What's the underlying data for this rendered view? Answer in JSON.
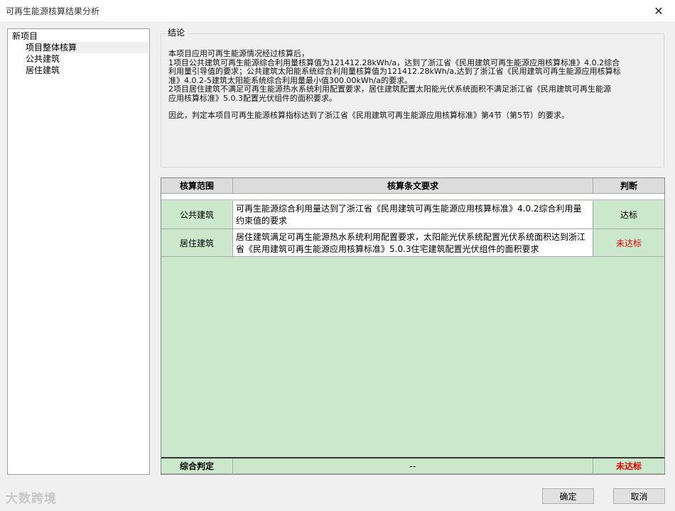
{
  "window": {
    "title": "可再生能源核算结果分析",
    "close_icon": "close-icon"
  },
  "tree": {
    "root": "新项目",
    "items": [
      "项目整体核算",
      "公共建筑",
      "居住建筑"
    ],
    "selected": "项目整体核算"
  },
  "conclusion": {
    "legend": "结论",
    "lines": [
      "本项目应用可再生能源情况经过核算后，",
      " 1项目公共建筑可再生能源综合利用量核算值为121412.28kWh/a，达到了浙江省《民用建筑可再生能源应用核算标准》4.0.2综合",
      "利用量引导值的要求；公共建筑太阳能系统综合利用量核算值为121412.28kWh/a,达到了浙江省《民用建筑可再生能源应用核算标",
      "准》4.0.2-5建筑太阳能系统综合利用量最小值300.00kWh/a的要求。",
      " 2项目居住建筑不满足可再生能源热水系统利用配置要求，居住建筑配置太阳能光伏系统面积不满足浙江省《民用建筑可再生能源",
      "应用核算标准》5.0.3配置光伏组件的面积要求。"
    ],
    "final": "因此，判定本项目可再生能源核算指标达到了浙江省《民用建筑可再生能源应用核算标准》第4节（第5节）的要求。"
  },
  "grid": {
    "headers": [
      "核算范围",
      "核算条文要求",
      "判断"
    ],
    "rows": [
      {
        "scope": "公共建筑",
        "req": "可再生能源综合利用量达到了浙江省《民用建筑可再生能源应用核算标准》4.0.2综合利用量约束值的要求",
        "result": "达标"
      },
      {
        "scope": "居住建筑",
        "req": "居住建筑满足可再生能源热水系统利用配置要求，太阳能光伏系统配置光伏系统面积达到浙江省《民用建筑可再生能源应用核算标准》5.0.3住宅建筑配置光伏组件的面积要求",
        "result": "未达标"
      }
    ],
    "summary": {
      "label": "综合判定",
      "req": "--",
      "result": "未达标"
    },
    "colors": {
      "grid_bg": "#cce8cc",
      "fail": "#e00000"
    }
  },
  "buttons": {
    "ok": "确定",
    "cancel": "取消"
  },
  "watermark": "大数跨境"
}
